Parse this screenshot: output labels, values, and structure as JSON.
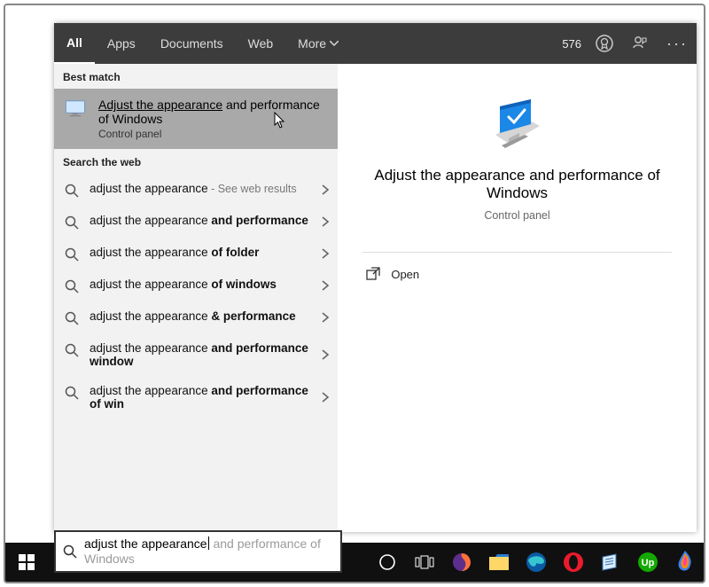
{
  "tabs": {
    "all": "All",
    "apps": "Apps",
    "documents": "Documents",
    "web": "Web",
    "more": "More"
  },
  "header": {
    "points": "576"
  },
  "sections": {
    "best_match": "Best match",
    "search_web": "Search the web"
  },
  "best_match": {
    "title_plain": "Adjust the appearance",
    "title_rest": " and performance of Windows",
    "subtitle": "Control panel"
  },
  "web_results": [
    {
      "plain": "adjust the appearance",
      "bold": "",
      "hint": " - See web results"
    },
    {
      "plain": "adjust the appearance ",
      "bold": "and performance",
      "hint": ""
    },
    {
      "plain": "adjust the appearance ",
      "bold": "of folder",
      "hint": ""
    },
    {
      "plain": "adjust the appearance ",
      "bold": "of windows",
      "hint": ""
    },
    {
      "plain": "adjust the appearance ",
      "bold": "& performance",
      "hint": ""
    },
    {
      "plain": "adjust the appearance ",
      "bold": "and performance window",
      "hint": ""
    },
    {
      "plain": "adjust the appearance ",
      "bold": "and performance of win",
      "hint": ""
    }
  ],
  "preview": {
    "title": "Adjust the appearance and performance of Windows",
    "subtitle": "Control panel",
    "open": "Open"
  },
  "search": {
    "typed": "adjust the appearance",
    "ghost": " and performance of Windows"
  },
  "colors": {
    "firefox": "#ff7139",
    "explorer_body": "#ffd768",
    "explorer_tab": "#2b7cd3",
    "edge_outer": "#0c59a4",
    "edge_inner": "#37c6d0",
    "opera": "#ea1b2c",
    "upwork": "#14a800",
    "flame_top": "#ff3db0",
    "flame_mid": "#ff8a00",
    "flame_bot": "#3b82f6"
  }
}
